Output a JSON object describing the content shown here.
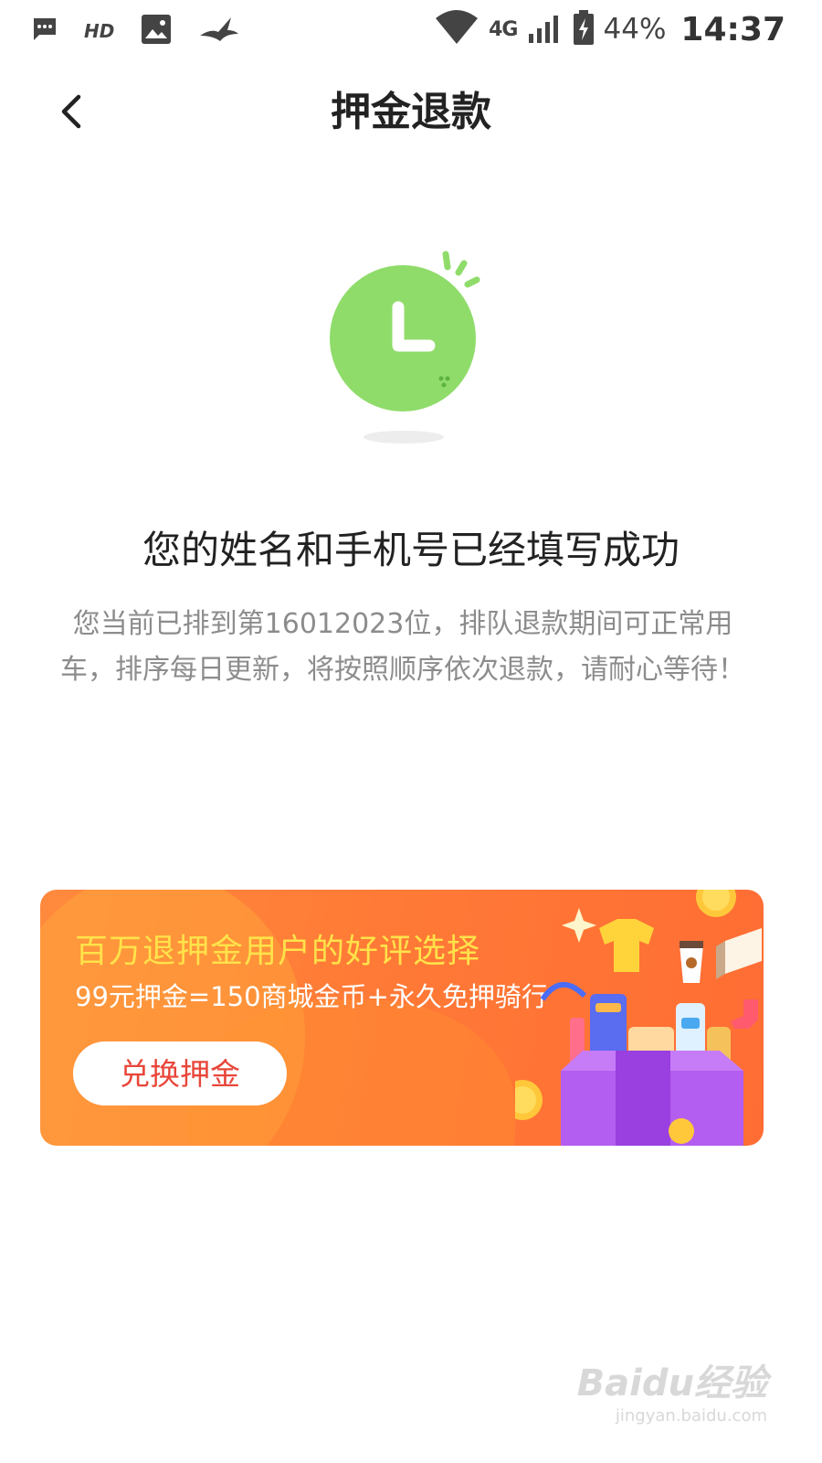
{
  "status_bar": {
    "icons": [
      "message-icon",
      "hd-icon",
      "image-icon",
      "bird-icon",
      "wifi-icon",
      "signal-icon",
      "battery-icon"
    ],
    "hd_text": "HD",
    "network": "4G",
    "battery": "44%",
    "time": "14:37"
  },
  "header": {
    "title": "押金退款",
    "back_icon": "chevron-left-icon"
  },
  "illustration": {
    "icon": "clock-icon",
    "color": "#8fdc6a"
  },
  "content": {
    "headline": "您的姓名和手机号已经填写成功",
    "description": "您当前已排到第16012023位，排队退款期间可正常用车，排序每日更新，将按照顺序依次退款，请耐心等待！"
  },
  "banner": {
    "title": "百万退押金用户的好评选择",
    "subtitle": "99元押金=150商城金币+永久免押骑行",
    "button_label": "兑换押金",
    "colors": {
      "background": "#ff7a36",
      "title": "#ffe24a",
      "button_text": "#e8463a"
    }
  },
  "watermark": {
    "logo": "Baidu经验",
    "url": "jingyan.baidu.com"
  }
}
